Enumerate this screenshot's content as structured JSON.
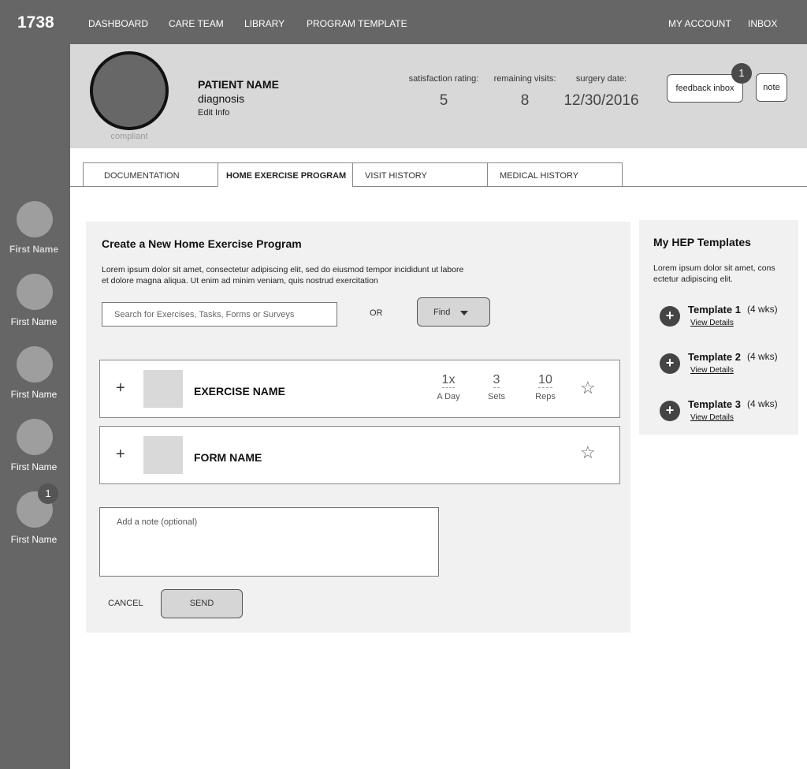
{
  "app": {
    "logo": "1738"
  },
  "nav": {
    "dashboard": "DASHBOARD",
    "care_team": "CARE TEAM",
    "library": "LIBRARY",
    "program_template": "PROGRAM TEMPLATE",
    "my_account": "MY ACCOUNT",
    "inbox": "INBOX"
  },
  "sidebar": {
    "patients": [
      {
        "name": "First Name",
        "badge": ""
      },
      {
        "name": "First Name",
        "badge": ""
      },
      {
        "name": "First Name",
        "badge": ""
      },
      {
        "name": "First Name",
        "badge": ""
      },
      {
        "name": "First Name",
        "badge": "1"
      }
    ]
  },
  "patient": {
    "name": "PATIENT NAME",
    "diagnosis": "diagnosis",
    "edit_info": "Edit Info",
    "status": "compliant",
    "stats": {
      "satisfaction_label": "satisfaction rating:",
      "satisfaction_value": "5",
      "visits_label": "remaining visits:",
      "visits_value": "8",
      "surgery_label": "surgery date:",
      "surgery_value": "12/30/2016"
    },
    "feedback_inbox_label": "feedback inbox",
    "feedback_badge": "1",
    "note_label": "note"
  },
  "tabs": {
    "documentation": "DOCUMENTATION",
    "home_exercise_program": "HOME EXERCISE PROGRAM",
    "visit_history": "VISIT HISTORY",
    "medical_history": "MEDICAL HISTORY",
    "active": "home_exercise_program"
  },
  "hep": {
    "title": "Create a New Home Exercise Program",
    "description": "Lorem ipsum dolor sit amet, consectetur adipiscing elit, sed do eiusmod tempor incididunt ut labore et dolore magna aliqua. Ut enim ad minim veniam, quis nostrud exercitation",
    "search_placeholder": "Search for Exercises, Tasks, Forms or Surveys",
    "or_label": "OR",
    "find_label": "Find",
    "exercise": {
      "plus": "+",
      "name": "EXERCISE NAME",
      "frequency_value": "1x",
      "frequency_label": "A Day",
      "sets_value": "3",
      "sets_label": "Sets",
      "reps_value": "10",
      "reps_label": "Reps",
      "star": "☆"
    },
    "form": {
      "plus": "+",
      "name": "FORM NAME",
      "star": "☆"
    },
    "note_placeholder": "Add a note (optional)",
    "cancel_label": "CANCEL",
    "send_label": "SEND"
  },
  "templates": {
    "title": "My HEP Templates",
    "description": "Lorem ipsum dolor sit amet, cons ectetur adipiscing elit.",
    "items": [
      {
        "name": "Template 1",
        "duration": "(4 wks)",
        "link": "View Details",
        "add": "+"
      },
      {
        "name": "Template 2",
        "duration": "(4 wks)",
        "link": "View Details",
        "add": "+"
      },
      {
        "name": "Template 3",
        "duration": "(4 wks)",
        "link": "View Details",
        "add": "+"
      }
    ]
  }
}
